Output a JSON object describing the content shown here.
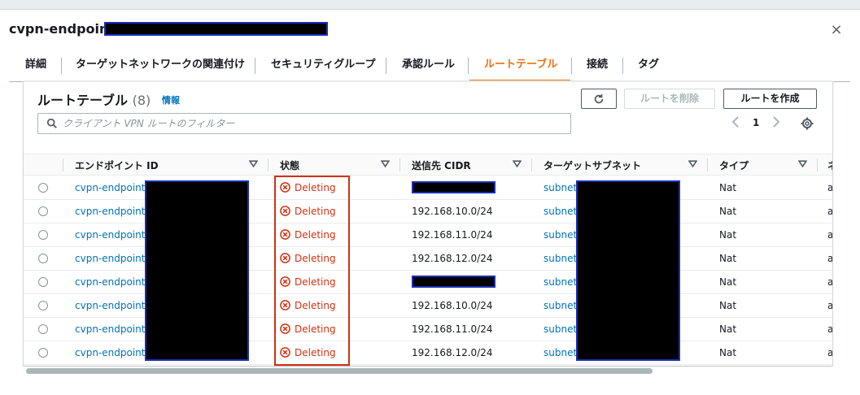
{
  "modal": {
    "title": "cvpn-endpoint-",
    "close_label": "×"
  },
  "tabs": [
    {
      "label": "詳細"
    },
    {
      "label": "ターゲットネットワークの関連付け"
    },
    {
      "label": "セキュリティグループ"
    },
    {
      "label": "承認ルール"
    },
    {
      "label": "ルートテーブル"
    },
    {
      "label": "接続"
    },
    {
      "label": "タグ"
    }
  ],
  "active_tab": "ルートテーブル",
  "card": {
    "title": "ルートテーブル",
    "count": "(8)",
    "info": "情報",
    "delete_button": "ルートを削除",
    "create_button": "ルートを作成",
    "search_placeholder": "クライアント VPN ルートのフィルター",
    "page": "1"
  },
  "columns": [
    {
      "label": "エンドポイント ID"
    },
    {
      "label": "状態"
    },
    {
      "label": "送信先 CIDR"
    },
    {
      "label": "ターゲットサブネット"
    },
    {
      "label": "タイプ"
    },
    {
      "label": "ネ"
    }
  ],
  "rows": [
    {
      "endpoint": "cvpn-endpoint-",
      "status": "Deleting",
      "cidr": "",
      "cidr_redacted": true,
      "subnet": "subnet-",
      "type": "Nat",
      "extra": "a"
    },
    {
      "endpoint": "cvpn-endpoint-",
      "status": "Deleting",
      "cidr": "192.168.10.0/24",
      "cidr_redacted": false,
      "subnet": "subnet-",
      "type": "Nat",
      "extra": "a"
    },
    {
      "endpoint": "cvpn-endpoint-",
      "status": "Deleting",
      "cidr": "192.168.11.0/24",
      "cidr_redacted": false,
      "subnet": "subnet-",
      "type": "Nat",
      "extra": "a"
    },
    {
      "endpoint": "cvpn-endpoint-",
      "status": "Deleting",
      "cidr": "192.168.12.0/24",
      "cidr_redacted": false,
      "subnet": "subnet-",
      "type": "Nat",
      "extra": "a"
    },
    {
      "endpoint": "cvpn-endpoint-",
      "status": "Deleting",
      "cidr": "",
      "cidr_redacted": true,
      "subnet": "subnet-",
      "type": "Nat",
      "extra": "a"
    },
    {
      "endpoint": "cvpn-endpoint-",
      "status": "Deleting",
      "cidr": "192.168.10.0/24",
      "cidr_redacted": false,
      "subnet": "subnet-",
      "type": "Nat",
      "extra": "a"
    },
    {
      "endpoint": "cvpn-endpoint-",
      "status": "Deleting",
      "cidr": "192.168.11.0/24",
      "cidr_redacted": false,
      "subnet": "subnet-",
      "type": "Nat",
      "extra": "a"
    },
    {
      "endpoint": "cvpn-endpoint-",
      "status": "Deleting",
      "cidr": "192.168.12.0/24",
      "cidr_redacted": false,
      "subnet": "subnet-",
      "type": "Nat",
      "extra": "a"
    }
  ],
  "colors": {
    "accent": "#ec7211",
    "link": "#0073bb",
    "error": "#d13212",
    "redaction_border": "#1a2fb8"
  }
}
